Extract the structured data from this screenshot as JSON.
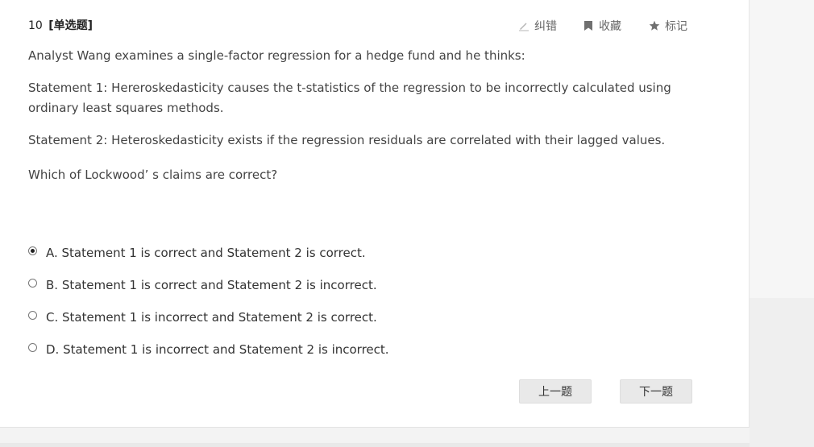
{
  "question": {
    "number": "10",
    "type_label": "[单选题]",
    "intro": "Analyst Wang examines a single-factor regression for a hedge fund and he thinks:",
    "statement1": "Statement 1: Hereroskedasticity causes the t-statistics of the regression to be incorrectly calculated using ordinary least squares methods.",
    "statement2": "Statement 2: Heteroskedasticity exists if the regression residuals are correlated with their lagged values.",
    "prompt": "Which of Lockwood’ s claims are correct?"
  },
  "tools": {
    "correct_label": "纠错",
    "favorite_label": "收藏",
    "mark_label": "标记",
    "icons": [
      "pencil-icon",
      "bookmark-icon",
      "star-icon"
    ]
  },
  "options": [
    {
      "label": "A. Statement 1 is correct and Statement 2 is correct.",
      "selected": true
    },
    {
      "label": "B. Statement 1 is correct and Statement 2 is incorrect.",
      "selected": false
    },
    {
      "label": "C. Statement 1 is incorrect and Statement 2 is correct.",
      "selected": false
    },
    {
      "label": "D. Statement 1 is incorrect and Statement 2 is incorrect.",
      "selected": false
    }
  ],
  "navigation": {
    "prev_label": "上一题",
    "next_label": "下一题"
  },
  "colors": {
    "card_bg": "#ffffff",
    "page_bg": "#f3f3f3",
    "button_bg": "#e9e9e9",
    "text": "#333333",
    "tool_text": "#666666"
  }
}
